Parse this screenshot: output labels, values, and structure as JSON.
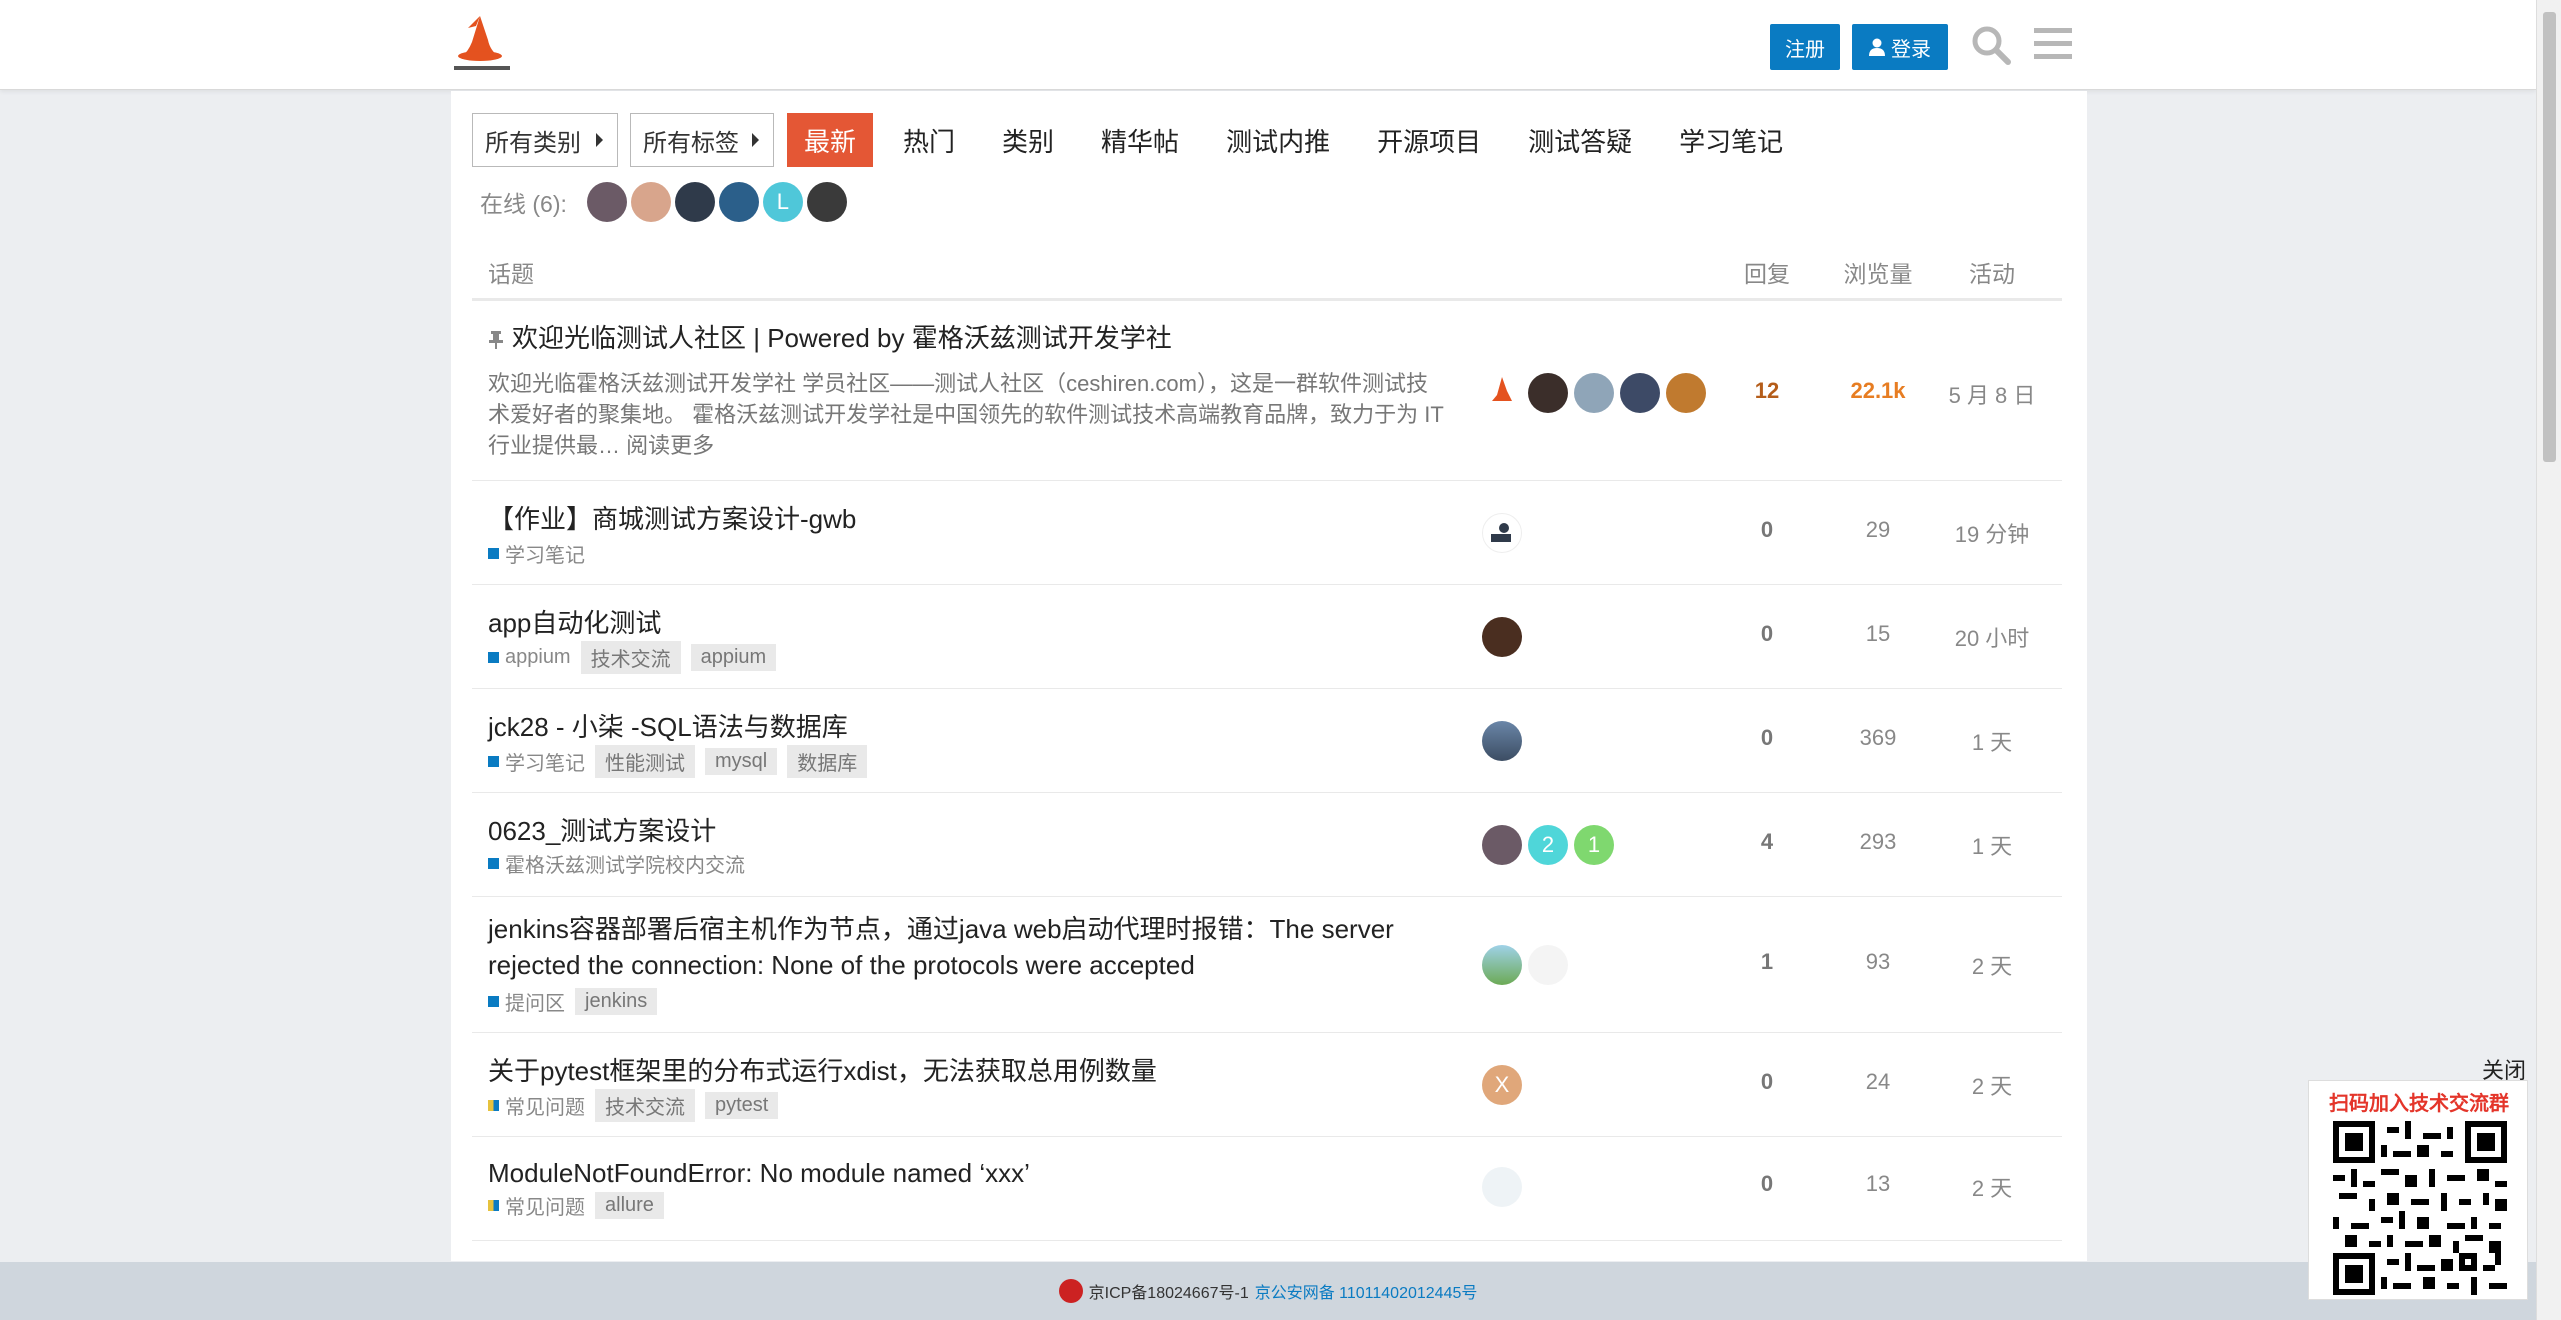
{
  "header": {
    "register_label": "注册",
    "login_label": "登录"
  },
  "nav": {
    "categories_dropdown": "所有类别",
    "tags_dropdown": "所有标签",
    "items": [
      "最新",
      "热门",
      "类别",
      "精华帖",
      "测试内推",
      "开源项目",
      "测试答疑",
      "学习笔记"
    ]
  },
  "online": {
    "label": "在线 (6):",
    "avatars": [
      {
        "color": "#6b5a66"
      },
      {
        "color": "#d8a58c"
      },
      {
        "color": "#2f3a4a"
      },
      {
        "color": "#2b5f8a"
      },
      {
        "color": "#4fc7d9",
        "letter": "L"
      },
      {
        "color": "#3a3a3a"
      }
    ]
  },
  "table": {
    "head_topic": "话题",
    "head_replies": "回复",
    "head_views": "浏览量",
    "head_activity": "活动"
  },
  "topics": [
    {
      "title": "欢迎光临测试人社区 | Powered by 霍格沃兹测试开发学社",
      "pinned": true,
      "excerpt": "欢迎光临霍格沃兹测试开发学社 学员社区——测试人社区（ceshiren.com），这是一群软件测试技术爱好者的聚集地。 霍格沃兹测试开发学社是中国领先的软件测试技术高端教育品牌，致力于为 IT 行业提供最…",
      "excerpt_more": "阅读更多",
      "replies": "12",
      "views": "22.1k",
      "activity": "5 月 8 日"
    },
    {
      "title": "【作业】商城测试方案设计-gwb",
      "category": "学习笔记",
      "tags": [],
      "replies": "0",
      "views": "29",
      "activity": "19 分钟"
    },
    {
      "title": "app自动化测试",
      "category": "appium",
      "tags": [
        "技术交流",
        "appium"
      ],
      "replies": "0",
      "views": "15",
      "activity": "20 小时"
    },
    {
      "title": "jck28 - 小柒 -SQL语法与数据库",
      "category": "学习笔记",
      "tags": [
        "性能测试",
        "mysql",
        "数据库"
      ],
      "replies": "0",
      "views": "369",
      "activity": "1 天"
    },
    {
      "title": "0623_测试方案设计",
      "category": "霍格沃兹测试学院校内交流",
      "tags": [],
      "replies": "4",
      "views": "293",
      "activity": "1 天",
      "poster_letters": [
        "2",
        "1"
      ]
    },
    {
      "title_line1": "jenkins容器部署后宿主机作为节点，通过java web启动代理时报错：The server",
      "title_line2": "rejected the connection: None of the protocols were accepted",
      "category": "提问区",
      "tags": [
        "jenkins"
      ],
      "replies": "1",
      "views": "93",
      "activity": "2 天"
    },
    {
      "title": "关于pytest框架里的分布式运行xdist，无法获取总用例数量",
      "category": "常见问题",
      "tags": [
        "技术交流",
        "pytest"
      ],
      "replies": "0",
      "views": "24",
      "activity": "2 天",
      "poster_letter": "X"
    },
    {
      "title": "ModuleNotFoundError: No module named ‘xxx’",
      "category": "常见问题",
      "tags": [
        "allure"
      ],
      "replies": "0",
      "views": "13",
      "activity": "2 天"
    }
  ],
  "footer": {
    "icp": "京ICP备18024667号-1",
    "police": "京公安网备 11011402012445号"
  },
  "qr_popup": {
    "close_label": "关闭",
    "title": "扫码加入技术交流群"
  },
  "colors": {
    "accent": "#e45735",
    "brand_blue": "#0a7bc2",
    "hot_replies": "#b55d1a",
    "hot_views": "#e77d22"
  }
}
